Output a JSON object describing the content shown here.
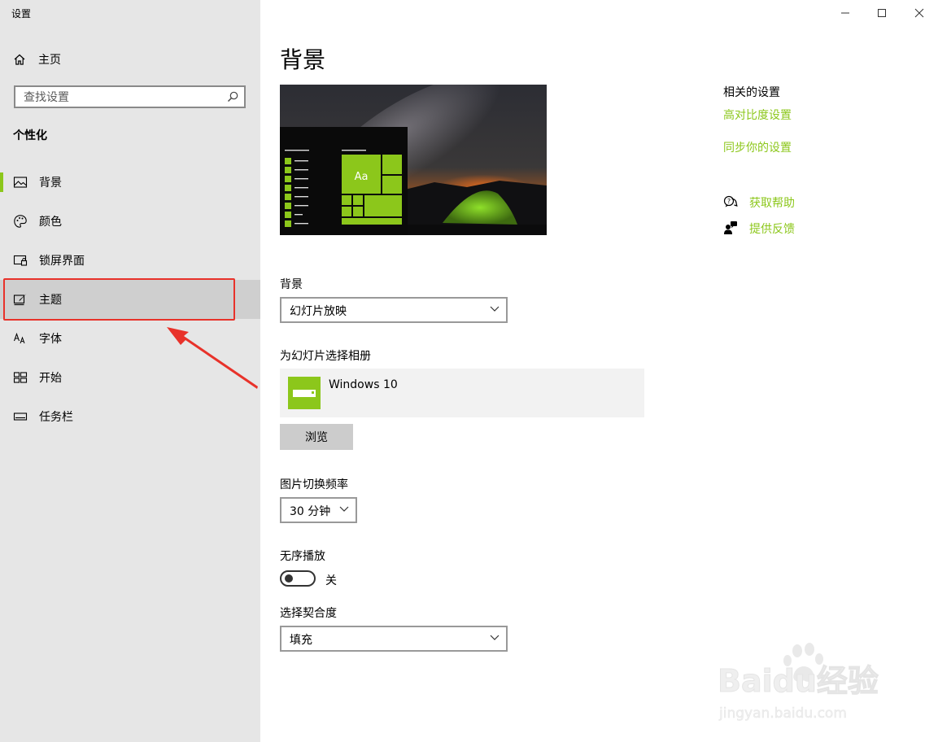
{
  "window": {
    "title": "设置",
    "controls": [
      "minimize",
      "maximize",
      "close"
    ]
  },
  "sidebar": {
    "home_label": "主页",
    "search_placeholder": "查找设置",
    "section_title": "个性化",
    "items": [
      {
        "label": "背景",
        "icon": "picture-icon"
      },
      {
        "label": "颜色",
        "icon": "palette-icon"
      },
      {
        "label": "锁屏界面",
        "icon": "lock-screen-icon"
      },
      {
        "label": "主题",
        "icon": "theme-brush-icon"
      },
      {
        "label": "字体",
        "icon": "font-icon"
      },
      {
        "label": "开始",
        "icon": "start-grid-icon"
      },
      {
        "label": "任务栏",
        "icon": "taskbar-icon"
      }
    ],
    "preview_tile_text": "Aa"
  },
  "main": {
    "title": "背景",
    "background_label": "背景",
    "background_value": "幻灯片放映",
    "album_label": "为幻灯片选择相册",
    "album_name": "Windows 10",
    "browse_label": "浏览",
    "interval_label": "图片切换频率",
    "interval_value": "30 分钟",
    "shuffle_label": "无序播放",
    "shuffle_state": "关",
    "fit_label": "选择契合度",
    "fit_value": "填充"
  },
  "related": {
    "title": "相关的设置",
    "links": [
      "高对比度设置",
      "同步你的设置"
    ],
    "help": [
      {
        "label": "获取帮助",
        "icon": "help-chat-icon"
      },
      {
        "label": "提供反馈",
        "icon": "feedback-icon"
      }
    ]
  },
  "colors": {
    "accent": "#8cc71b",
    "sidebar_bg": "#e6e6e6",
    "highlight": "#e8322a"
  },
  "watermark": {
    "text": "Baidu经验",
    "url_text": "jingyan.baidu.com"
  }
}
